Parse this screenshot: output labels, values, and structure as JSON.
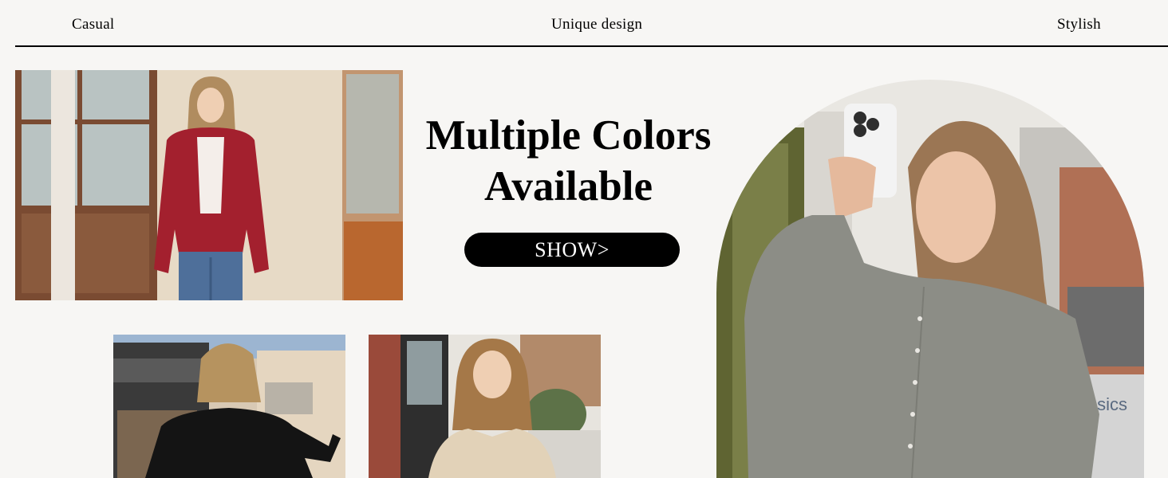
{
  "nav": {
    "left": "Casual",
    "center": "Unique design",
    "right": "Stylish"
  },
  "hero": {
    "headline_line1": "Multiple Colors",
    "headline_line2": "Available",
    "cta_label": "SHOW>"
  },
  "photos": {
    "red": {
      "subject": "woman-red-cardigan",
      "colors": {
        "garment": "#a3202e",
        "wall": "#e7dac6",
        "door": "#7a4b32"
      }
    },
    "black": {
      "subject": "woman-black-cardigan-back",
      "colors": {
        "garment": "#141414",
        "building": "#d8c9b4",
        "sign": "#3a3a3a"
      }
    },
    "beige": {
      "subject": "woman-beige-cardigan",
      "colors": {
        "garment": "#e2d2b8",
        "brick": "#9a4a3a",
        "trees": "#b28a6a"
      }
    },
    "grey": {
      "subject": "woman-grey-cardigan-selfie",
      "colors": {
        "garment": "#8c8d86",
        "backdrop": "#e9e7e2",
        "phone": "#f3f3f3"
      }
    },
    "grey_sign_text": "asics"
  }
}
